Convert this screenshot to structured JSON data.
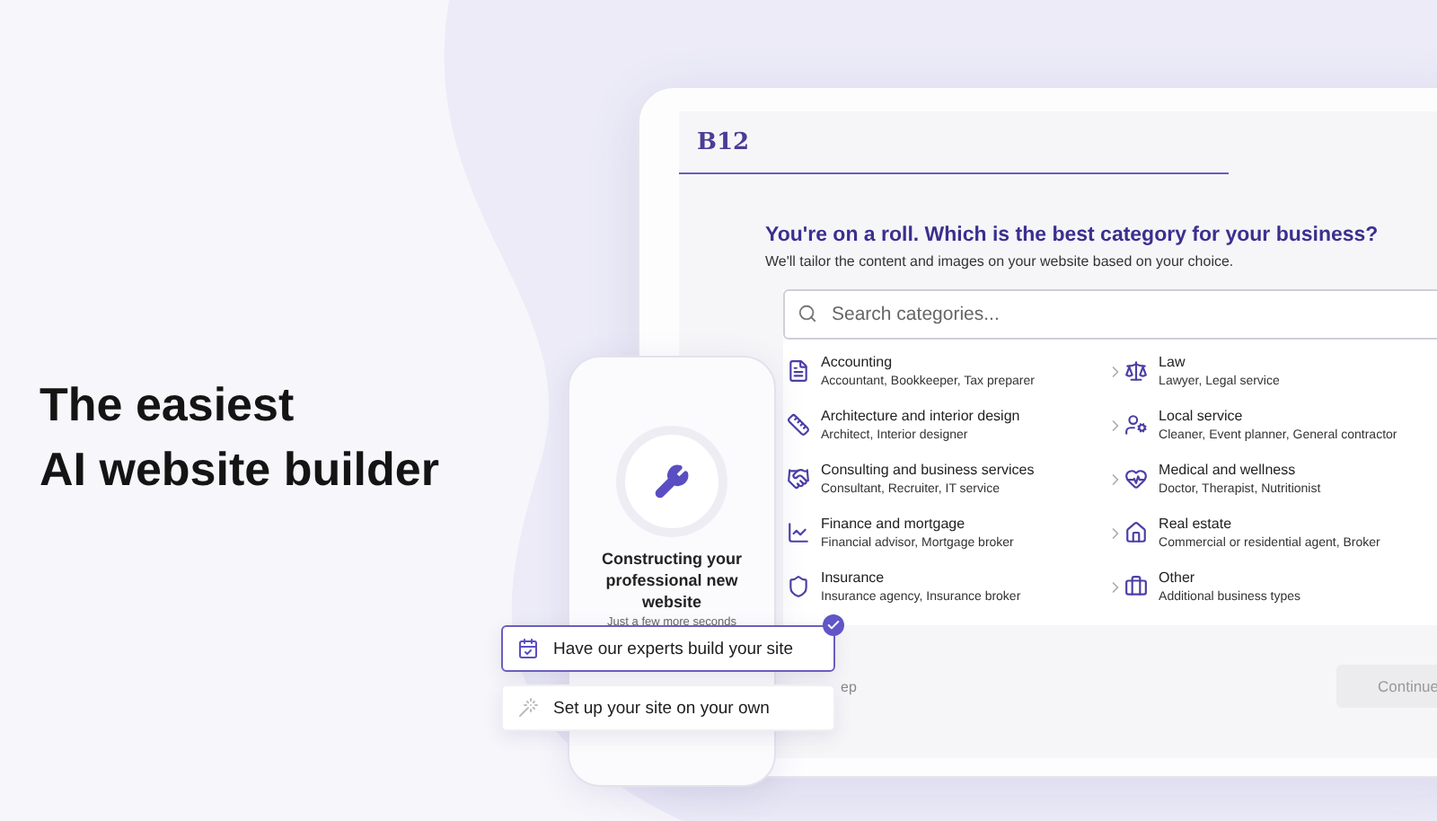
{
  "headline": [
    "The easiest",
    "AI website builder"
  ],
  "app": {
    "logo": "B12",
    "heading": "You're on a roll. Which is the best category for your business?",
    "subheading": "We'll tailor the content and images on your website based on your choice.",
    "search": {
      "placeholder": "Search categories..."
    },
    "category_columns": [
      {
        "items": [
          {
            "title": "Accounting",
            "examples": "Accountant, Bookkeeper, Tax preparer"
          },
          {
            "title": "Architecture and interior design",
            "examples": "Architect, Interior designer"
          },
          {
            "title": "Consulting and business services",
            "examples": "Consultant, Recruiter, IT service"
          },
          {
            "title": "Finance and mortgage",
            "examples": "Financial advisor, Mortgage broker"
          },
          {
            "title": "Insurance",
            "examples": "Insurance agency, Insurance broker"
          }
        ]
      },
      {
        "items": [
          {
            "title": "Law",
            "examples": "Lawyer, Legal service"
          },
          {
            "title": "Local service",
            "examples": "Cleaner, Event planner, General contractor"
          },
          {
            "title": "Medical and wellness",
            "examples": "Doctor, Therapist, Nutritionist"
          },
          {
            "title": "Real estate",
            "examples": "Commercial or residential agent, Broker"
          },
          {
            "title": "Other",
            "examples": "Additional business types"
          }
        ]
      }
    ],
    "footer": {
      "back_link": "ep",
      "continue_button": {
        "label": "Continue",
        "disabled": true
      }
    }
  },
  "phone": {
    "title": "Constructing your professional new website",
    "note": "Just a few more seconds"
  },
  "options": [
    {
      "label": "Have our experts build your site",
      "selected": true
    },
    {
      "label": "Set up your site on your own",
      "selected": false
    }
  ]
}
